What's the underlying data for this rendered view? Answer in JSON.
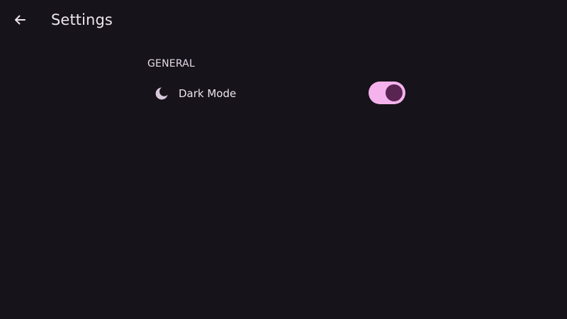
{
  "header": {
    "title": "Settings",
    "back_icon": "arrow-left-icon"
  },
  "sections": [
    {
      "title": "GENERAL",
      "items": [
        {
          "icon": "moon-icon",
          "label": "Dark Mode",
          "toggle_on": true
        }
      ]
    }
  ],
  "colors": {
    "background": "#17131a",
    "toggle_track": "#f4b3ec",
    "toggle_thumb": "#5a2452",
    "icon": "#d8c9da"
  }
}
